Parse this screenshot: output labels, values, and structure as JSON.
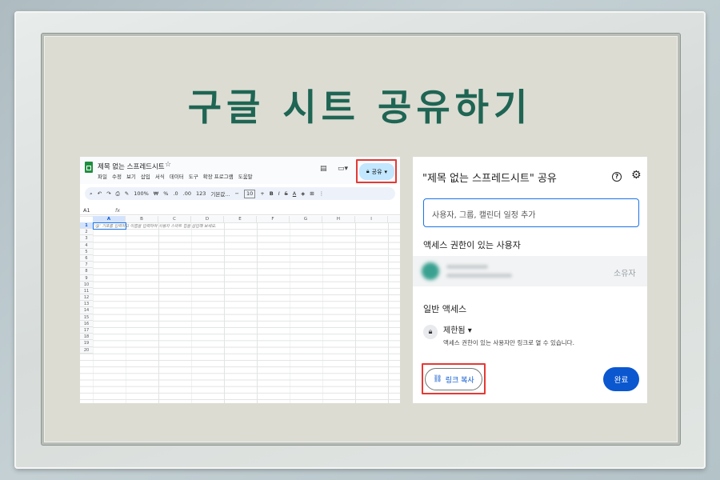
{
  "page": {
    "title": "구글 시트 공유하기"
  },
  "sheet": {
    "doc_title": "제목 없는 스프레드시트",
    "menu": [
      "파일",
      "수정",
      "보기",
      "삽입",
      "서식",
      "데이터",
      "도구",
      "확장 프로그램",
      "도움말"
    ],
    "share_label": "공유",
    "toolbar": {
      "zoom": "100%",
      "currency": "₩",
      "percent": "%",
      "decimal_less": ".0",
      "decimal_more": ".00",
      "number_format": "123",
      "font": "기본값...",
      "font_size": "10",
      "bold": "B",
      "italic": "I",
      "strike": "S",
      "text_color": "A"
    },
    "cell_ref": "A1",
    "fx": "fx",
    "columns": [
      "A",
      "B",
      "C",
      "D",
      "E",
      "F",
      "G",
      "H",
      "I"
    ],
    "rows": [
      "1",
      "2",
      "3",
      "4",
      "5",
      "6",
      "7",
      "8",
      "9",
      "10",
      "11",
      "12",
      "13",
      "14",
      "15",
      "16",
      "17",
      "18",
      "19",
      "20"
    ],
    "hint": "'@' 기호를 입력하고 이름을 입력하여 사용자 스마트 칩을 삽입해 보세요."
  },
  "dialog": {
    "title": "\"제목 없는 스프레드시트\" 공유",
    "input_placeholder": "사용자, 그룹, 캘린더 일정 추가",
    "people_section": "액세스 권한이 있는 사용자",
    "owner_role": "소유자",
    "general_section": "일반 액세스",
    "restricted": "제한됨",
    "access_desc": "액세스 권한이 있는 사용자만 링크로 열 수 있습니다.",
    "copy_link": "링크 복사",
    "done": "완료"
  },
  "colors": {
    "title": "#1f6553",
    "primary": "#0b57d0",
    "share_bg": "#c2e7ff",
    "highlight": "#e53935",
    "sheets_green": "#1e8e3e"
  },
  "icons": [
    "search-icon",
    "undo-icon",
    "redo-icon",
    "print-icon",
    "paint-format-icon",
    "comment-icon",
    "meet-icon",
    "lock-icon",
    "help-icon",
    "gear-icon",
    "link-icon",
    "star-icon"
  ]
}
